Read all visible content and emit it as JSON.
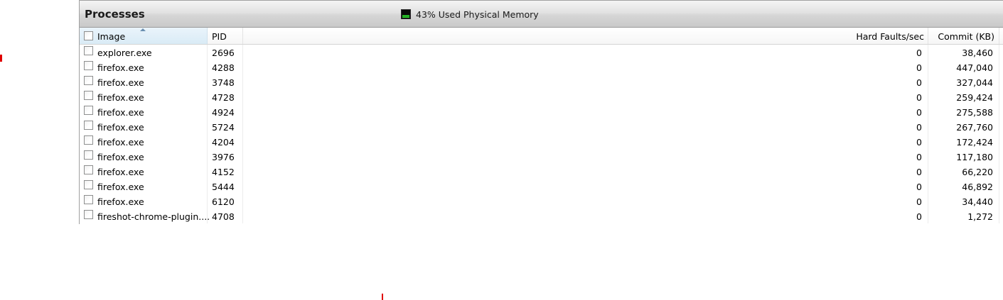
{
  "panel": {
    "title": "Processes",
    "memory": {
      "text": "43% Used Physical Memory",
      "used_percent": 43,
      "icon": "memory-meter-icon"
    }
  },
  "columns": {
    "image": "Image",
    "pid": "PID",
    "hard_faults": "Hard Faults/sec",
    "commit": "Commit (KB)"
  },
  "sort": {
    "column": "Image",
    "direction": "ascending"
  },
  "rows": [
    {
      "image": "explorer.exe",
      "pid": "2696",
      "hard_faults": "0",
      "commit": "38,460"
    },
    {
      "image": "firefox.exe",
      "pid": "4288",
      "hard_faults": "0",
      "commit": "447,040"
    },
    {
      "image": "firefox.exe",
      "pid": "3748",
      "hard_faults": "0",
      "commit": "327,044"
    },
    {
      "image": "firefox.exe",
      "pid": "4728",
      "hard_faults": "0",
      "commit": "259,424"
    },
    {
      "image": "firefox.exe",
      "pid": "4924",
      "hard_faults": "0",
      "commit": "275,588"
    },
    {
      "image": "firefox.exe",
      "pid": "5724",
      "hard_faults": "0",
      "commit": "267,760"
    },
    {
      "image": "firefox.exe",
      "pid": "4204",
      "hard_faults": "0",
      "commit": "172,424"
    },
    {
      "image": "firefox.exe",
      "pid": "3976",
      "hard_faults": "0",
      "commit": "117,180"
    },
    {
      "image": "firefox.exe",
      "pid": "4152",
      "hard_faults": "0",
      "commit": "66,220"
    },
    {
      "image": "firefox.exe",
      "pid": "5444",
      "hard_faults": "0",
      "commit": "46,892"
    },
    {
      "image": "firefox.exe",
      "pid": "6120",
      "hard_faults": "0",
      "commit": "34,440"
    },
    {
      "image": "fireshot-chrome-plugin....",
      "pid": "4708",
      "hard_faults": "0",
      "commit": "1,272"
    }
  ],
  "colors": {
    "header_selected": "#d9ebf6",
    "meter_green": "#33e033",
    "marker_red": "#e00000"
  }
}
